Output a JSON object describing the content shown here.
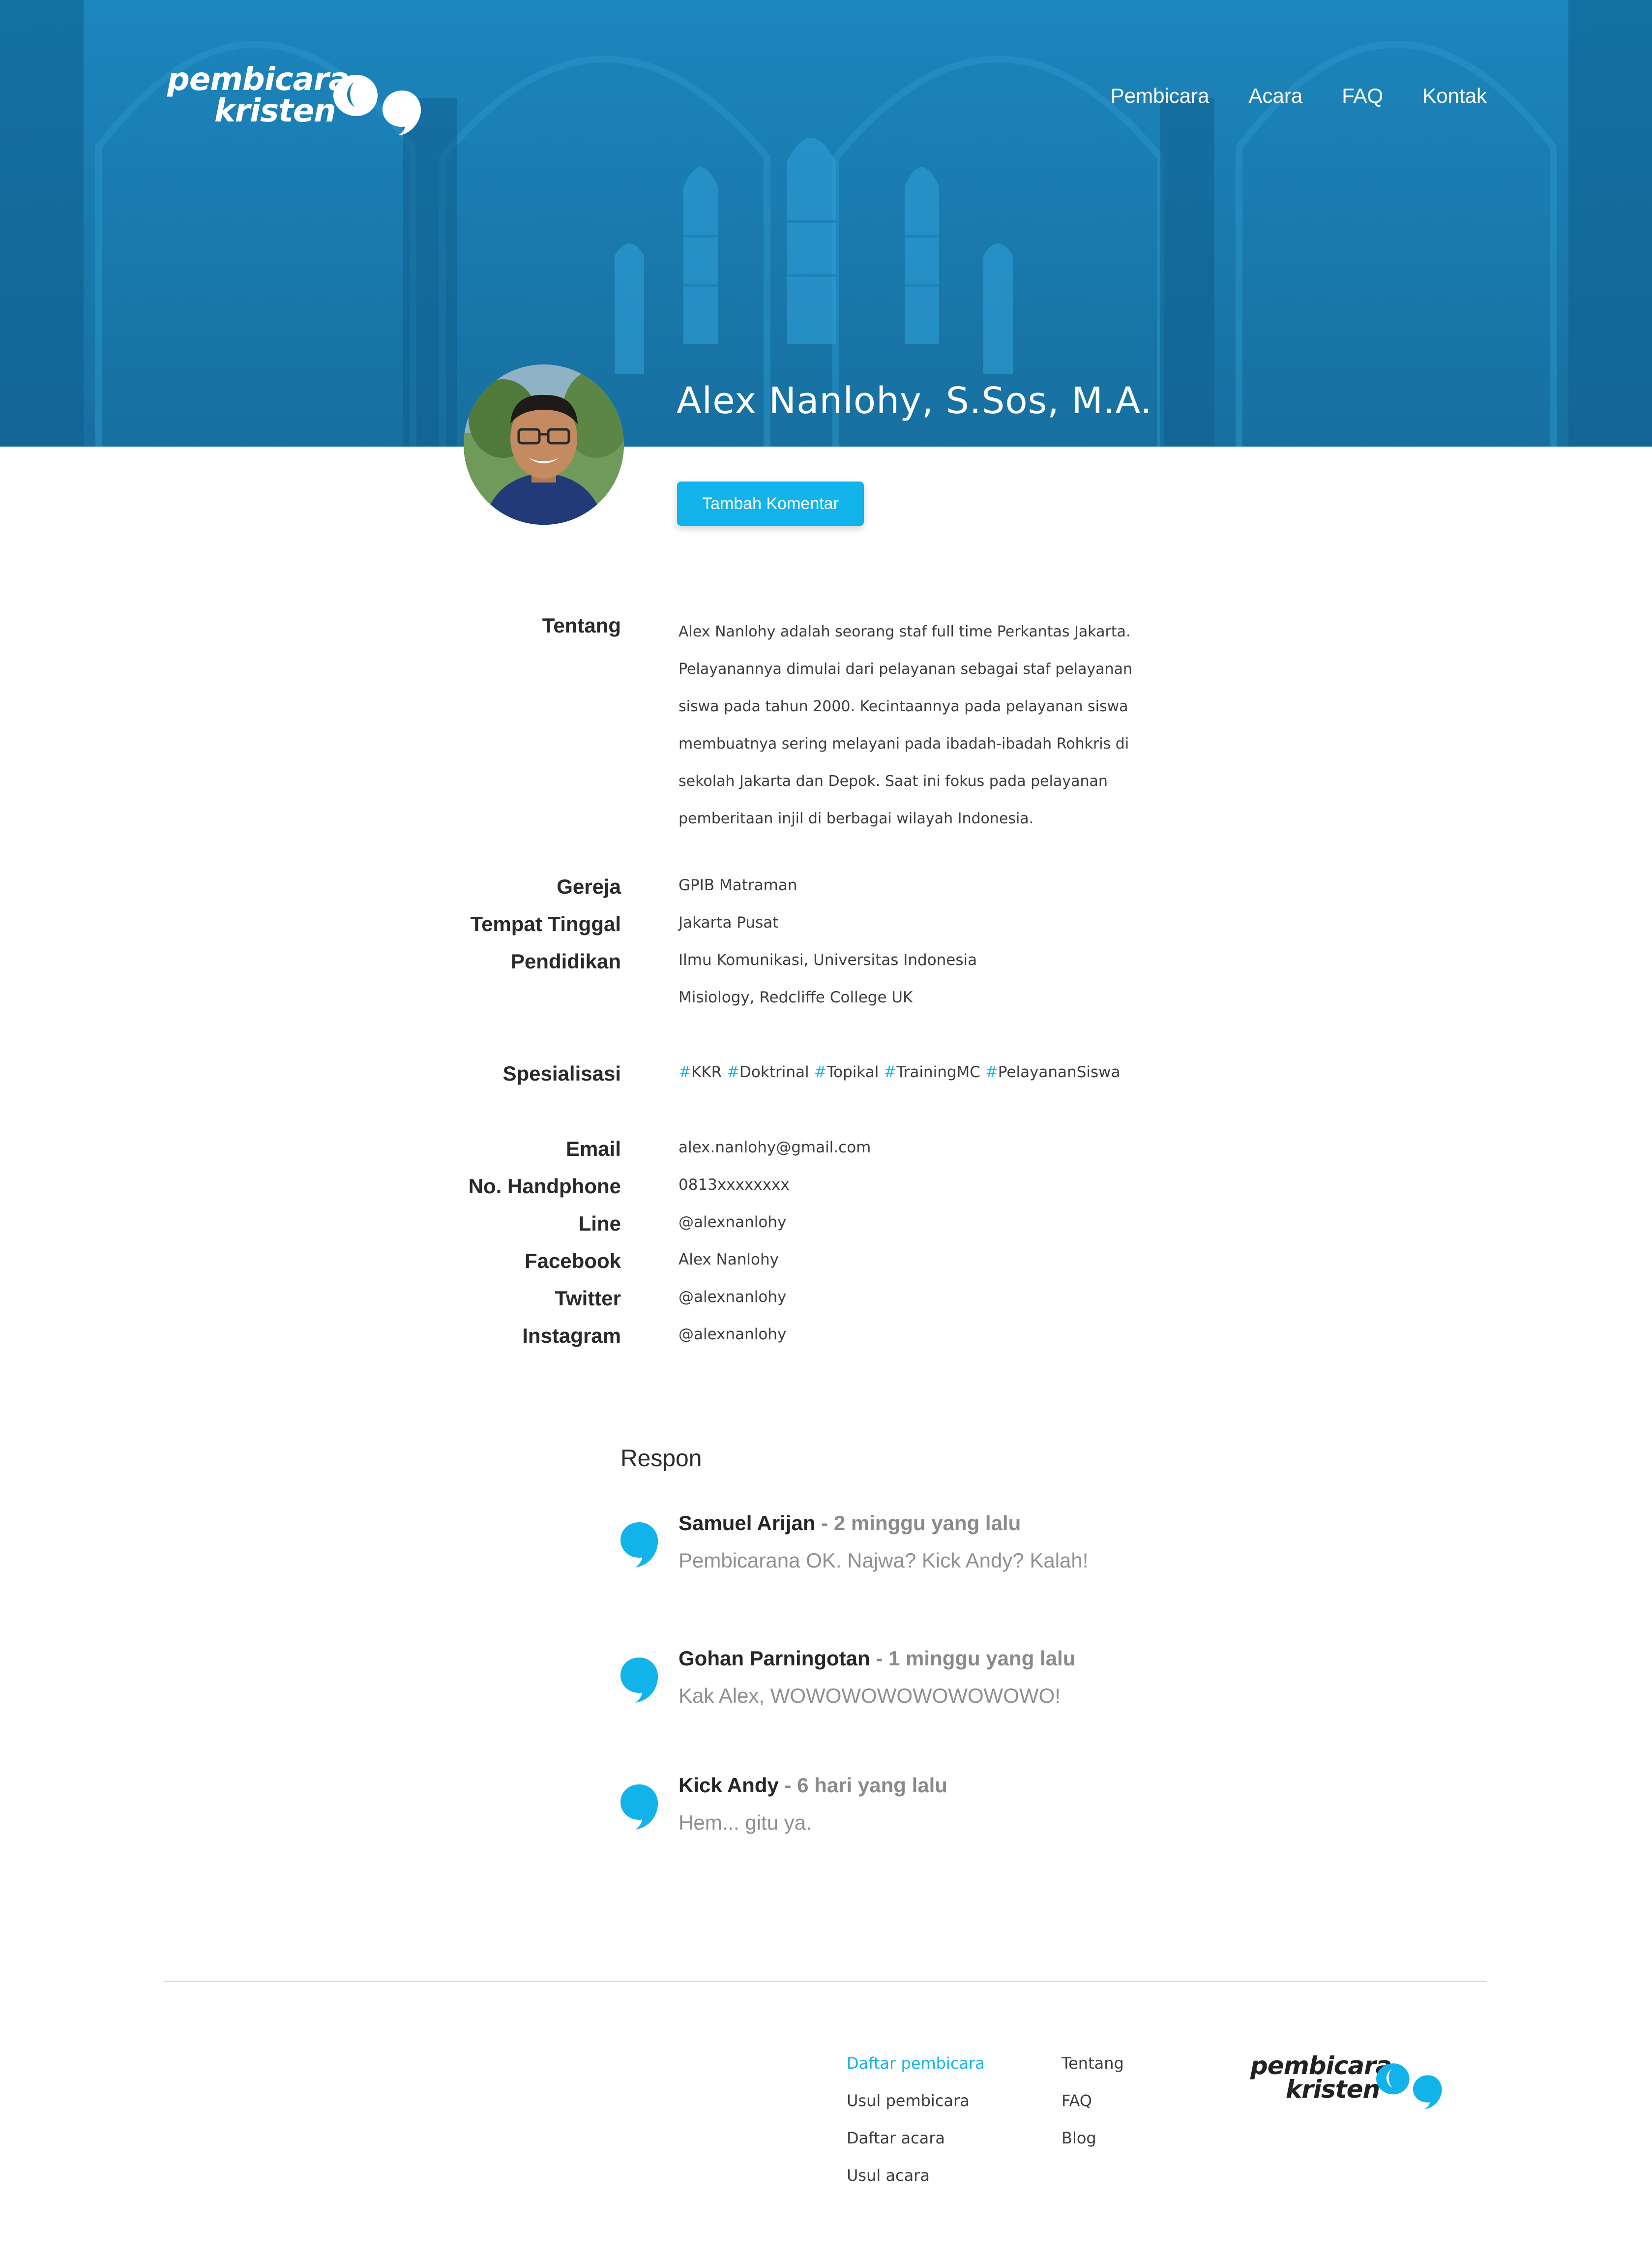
{
  "brand": {
    "name_line1": "pembicara",
    "name_line2": "kristen",
    "accent": "#12b3ea",
    "hero_color": "#1a7fb4"
  },
  "nav": [
    {
      "label": "Pembicara"
    },
    {
      "label": "Acara"
    },
    {
      "label": "FAQ"
    },
    {
      "label": "Kontak"
    }
  ],
  "speaker": {
    "name": "Alex Nanlohy, S.Sos, M.A.",
    "cta_label": "Tambah Komentar"
  },
  "profile": {
    "about_label": "Tentang",
    "about_lines": [
      "Alex Nanlohy adalah seorang staf full time Perkantas Jakarta.",
      "Pelayanannya dimulai dari pelayanan sebagai staf pelayanan",
      "siswa pada tahun 2000. Kecintaannya pada pelayanan siswa",
      "membuatnya sering melayani pada ibadah-ibadah Rohkris di",
      "sekolah Jakarta dan Depok. Saat ini fokus pada pelayanan",
      "pemberitaan injil di berbagai wilayah Indonesia."
    ],
    "church_label": "Gereja",
    "church": "GPIB Matraman",
    "residence_label": "Tempat Tinggal",
    "residence": "Jakarta Pusat",
    "education_label": "Pendidikan",
    "education": [
      "Ilmu Komunikasi, Universitas Indonesia",
      "Misiology, Redcliffe College UK"
    ],
    "specialization_label": "Spesialisasi",
    "tags": [
      "KKR",
      "Doktrinal",
      "Topikal",
      "TrainingMC",
      "PelayananSiswa"
    ],
    "contacts": {
      "email_label": "Email",
      "email": "alex.nanlohy@gmail.com",
      "phone_label": "No. Handphone",
      "phone": "0813xxxxxxxx",
      "line_label": "Line",
      "line": "@alexnanlohy",
      "facebook_label": "Facebook",
      "facebook": "Alex Nanlohy",
      "twitter_label": "Twitter",
      "twitter": "@alexnanlohy",
      "instagram_label": "Instagram",
      "instagram": "@alexnanlohy"
    }
  },
  "responses": {
    "title": "Respon",
    "items": [
      {
        "author": "Samuel Arijan",
        "time": " - 2 minggu yang lalu",
        "text": "Pembicarana OK. Najwa? Kick Andy? Kalah!"
      },
      {
        "author": "Gohan Parningotan",
        "time": " - 1 minggu yang lalu",
        "text": "Kak Alex, WOWOWOWOWOWOWOWO!"
      },
      {
        "author": "Kick Andy",
        "time": " - 6 hari yang lalu",
        "text": "Hem... gitu ya."
      }
    ]
  },
  "footer": {
    "col1": [
      "Daftar pembicara",
      "Usul pembicara",
      "Daftar acara",
      "Usul acara"
    ],
    "col2": [
      "Tentang",
      "FAQ",
      "Blog"
    ]
  }
}
